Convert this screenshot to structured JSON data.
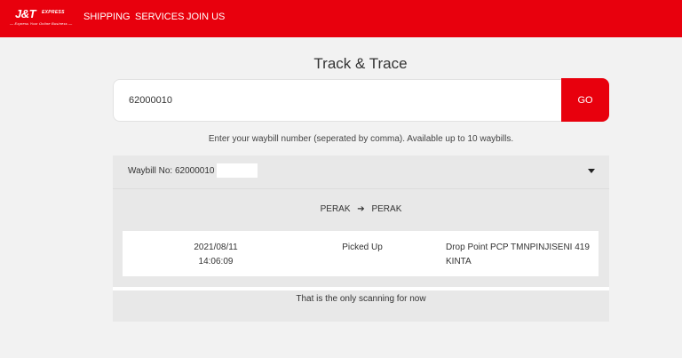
{
  "brand": {
    "name": "J&T",
    "name_sup": "EXPRESS",
    "tagline": "— Express Your Online Business —",
    "color": "#e8000d"
  },
  "nav": {
    "items": [
      {
        "label": "SHIPPING"
      },
      {
        "label": "SERVICES"
      },
      {
        "label": "JOIN US"
      }
    ]
  },
  "page": {
    "title": "Track & Trace"
  },
  "search": {
    "value": "62000010",
    "go_label": "GO",
    "hint": "Enter your waybill number (seperated by comma). Available up to 10 waybills."
  },
  "result": {
    "waybill_label": "Waybill No: 62000010",
    "route": {
      "from": "PERAK",
      "arrow_icon": "arrow-right-icon",
      "to": "PERAK"
    },
    "scans": [
      {
        "date": "2021/08/11",
        "time": "14:06:09",
        "status": "Picked Up",
        "location_line1": "Drop Point PCP TMNPINJISENI 419",
        "location_line2": "KINTA"
      }
    ],
    "footer_note": "That is the only scanning for now"
  }
}
